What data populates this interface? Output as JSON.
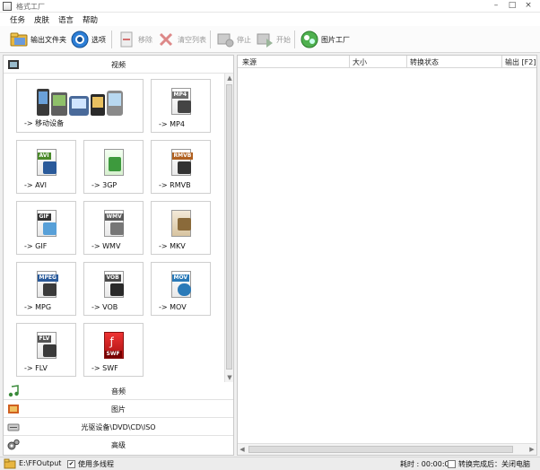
{
  "window": {
    "title": "格式工厂",
    "minimize": "–",
    "maximize": "□",
    "close": "×"
  },
  "menu": [
    "任务",
    "皮肤",
    "语言",
    "帮助"
  ],
  "toolbar": {
    "output_folder": "输出文件夹",
    "options": "选项",
    "remove": "移除",
    "clear_list": "清空列表",
    "stop": "停止",
    "start": "开始",
    "picture_factory": "图片工厂"
  },
  "categories": {
    "video": "视频",
    "audio": "音频",
    "picture": "图片",
    "rom": "光驱设备\\DVD\\CD\\ISO",
    "advanced": "高级"
  },
  "tiles": [
    {
      "label": "-> 移动设备",
      "tag": "",
      "color": ""
    },
    {
      "label": "-> MP4",
      "tag": "MP4",
      "color": "#6b6b6b"
    },
    {
      "label": "-> AVI",
      "tag": "AVI",
      "color": "#4a8a2a"
    },
    {
      "label": "-> 3GP",
      "tag": "",
      "color": "#3d9a3d"
    },
    {
      "label": "-> RMVB",
      "tag": "RMVB",
      "color": "#b06020"
    },
    {
      "label": "-> GIF",
      "tag": "GIF",
      "color": "#333333"
    },
    {
      "label": "-> WMV",
      "tag": "WMV",
      "color": "#5a5a5a"
    },
    {
      "label": "-> MKV",
      "tag": "",
      "color": "#8a6a3a"
    },
    {
      "label": "-> MPG",
      "tag": "MPEG",
      "color": "#2a5a9a"
    },
    {
      "label": "-> VOB",
      "tag": "VOB",
      "color": "#4a4a4a"
    },
    {
      "label": "-> MOV",
      "tag": "MOV",
      "color": "#2a7ab8"
    },
    {
      "label": "-> FLV",
      "tag": "FLV",
      "color": "#555555"
    },
    {
      "label": "-> SWF",
      "tag": "SWF",
      "color": "#c02020"
    }
  ],
  "list": {
    "columns": [
      "来源",
      "大小",
      "转换状态",
      "输出 [F2]"
    ]
  },
  "status": {
    "output_path": "E:\\FFOutput",
    "multithread_label": "使用多线程",
    "multithread_checked": "✔",
    "elapsed": "耗时 : 00:00:00",
    "after_convert": "转换完成后：关闭电脑"
  },
  "colors": {
    "accent": "#1e6fc8",
    "border": "#c9c9c9"
  }
}
